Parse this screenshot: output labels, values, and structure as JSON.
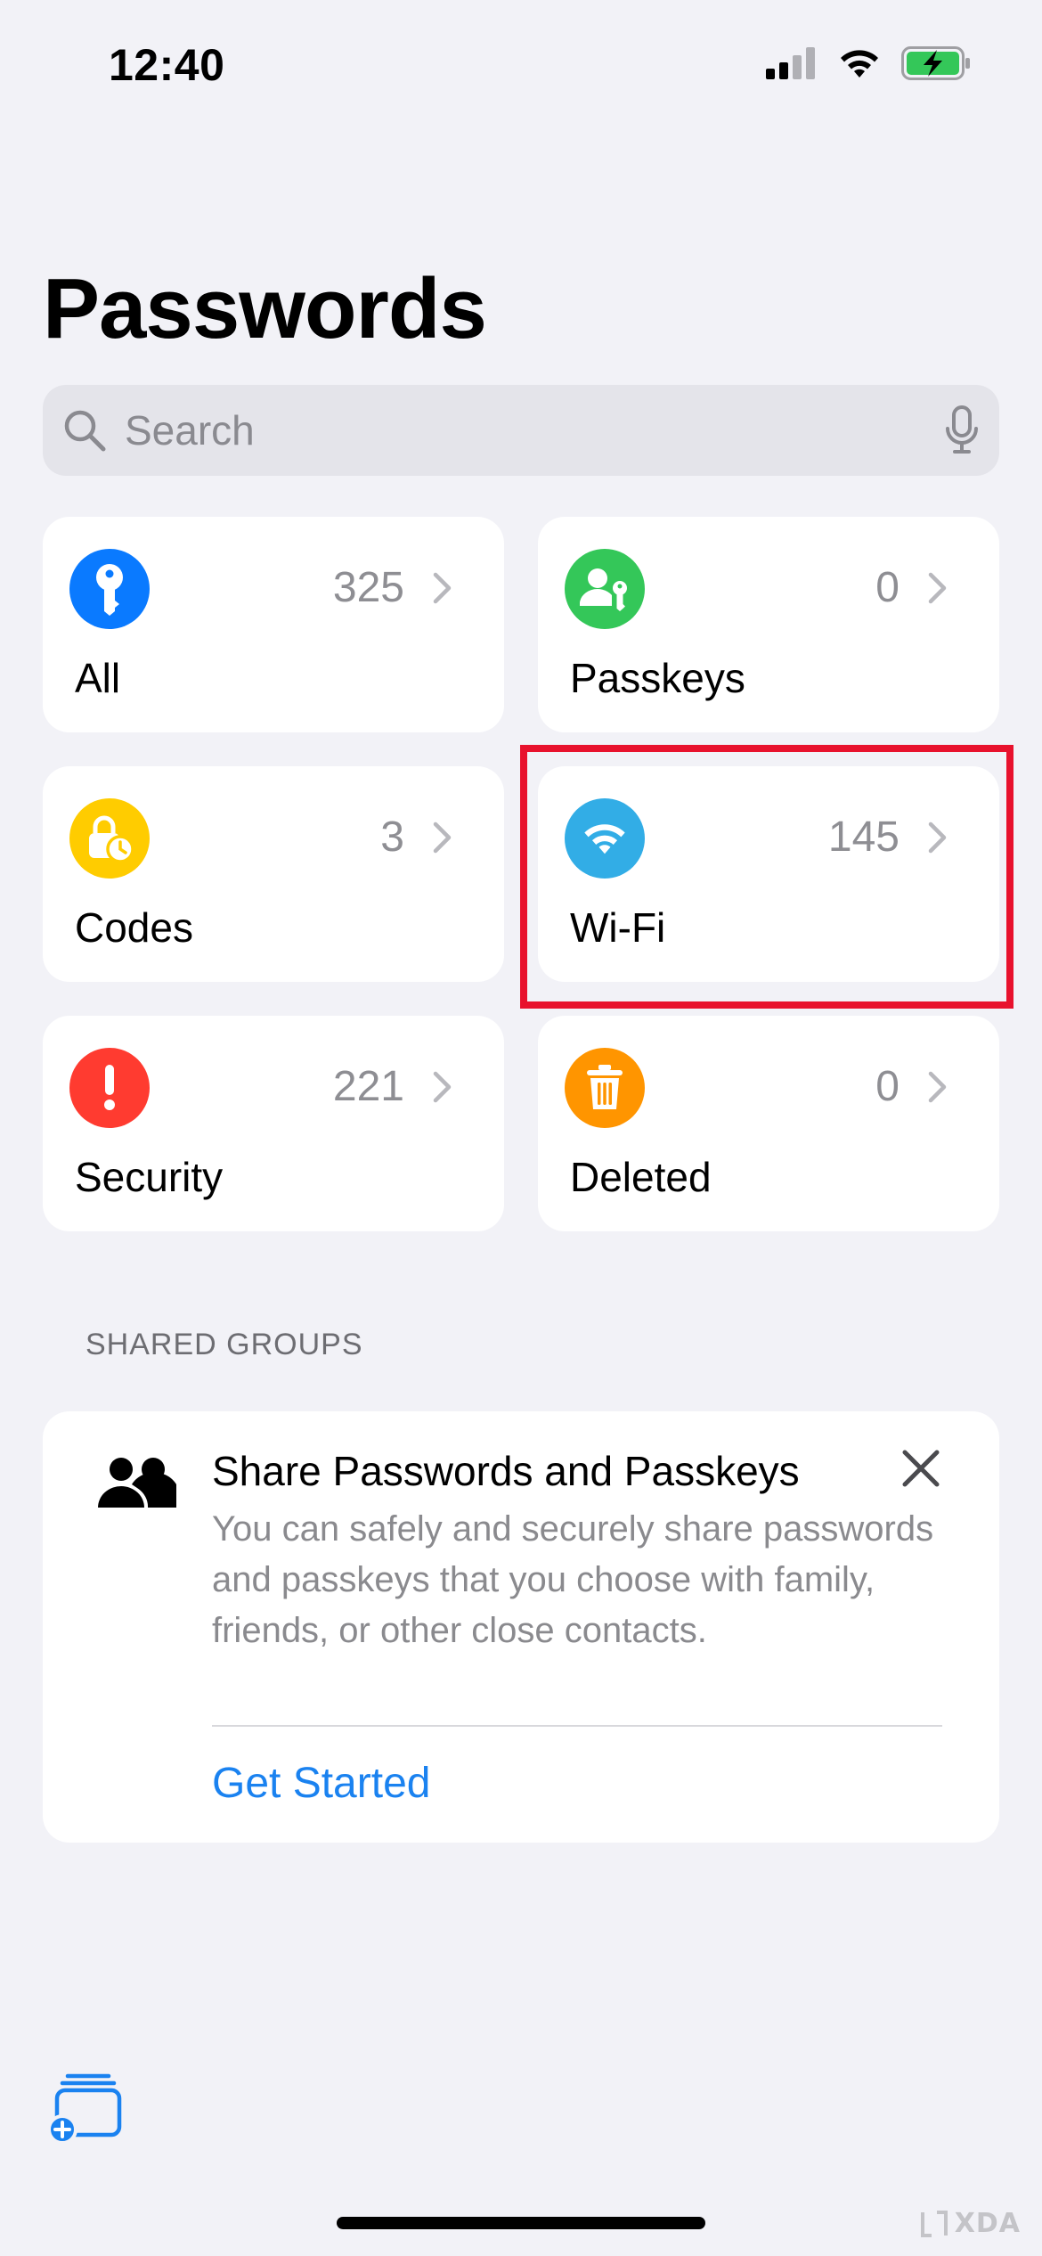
{
  "status_bar": {
    "time": "12:40"
  },
  "title": "Passwords",
  "search": {
    "placeholder": "Search"
  },
  "tiles": [
    {
      "label": "All",
      "count": "325",
      "icon": "key-icon",
      "color": "#0a7aff"
    },
    {
      "label": "Passkeys",
      "count": "0",
      "icon": "person-key-icon",
      "color": "#34c759"
    },
    {
      "label": "Codes",
      "count": "3",
      "icon": "lock-clock-icon",
      "color": "#ffcc00"
    },
    {
      "label": "Wi-Fi",
      "count": "145",
      "icon": "wifi-icon",
      "color": "#32ade6"
    },
    {
      "label": "Security",
      "count": "221",
      "icon": "exclamation-icon",
      "color": "#ff3b30"
    },
    {
      "label": "Deleted",
      "count": "0",
      "icon": "trash-icon",
      "color": "#ff9500"
    }
  ],
  "highlight": {
    "target": "Wi-Fi",
    "color": "#e8122d"
  },
  "shared_groups": {
    "header": "SHARED GROUPS",
    "card": {
      "title": "Share Passwords and Passkeys",
      "body": "You can safely and securely share passwords and passkeys that you choose with family, friends, or other close contacts.",
      "link": "Get Started"
    }
  },
  "watermark": {
    "text": "XDA"
  }
}
